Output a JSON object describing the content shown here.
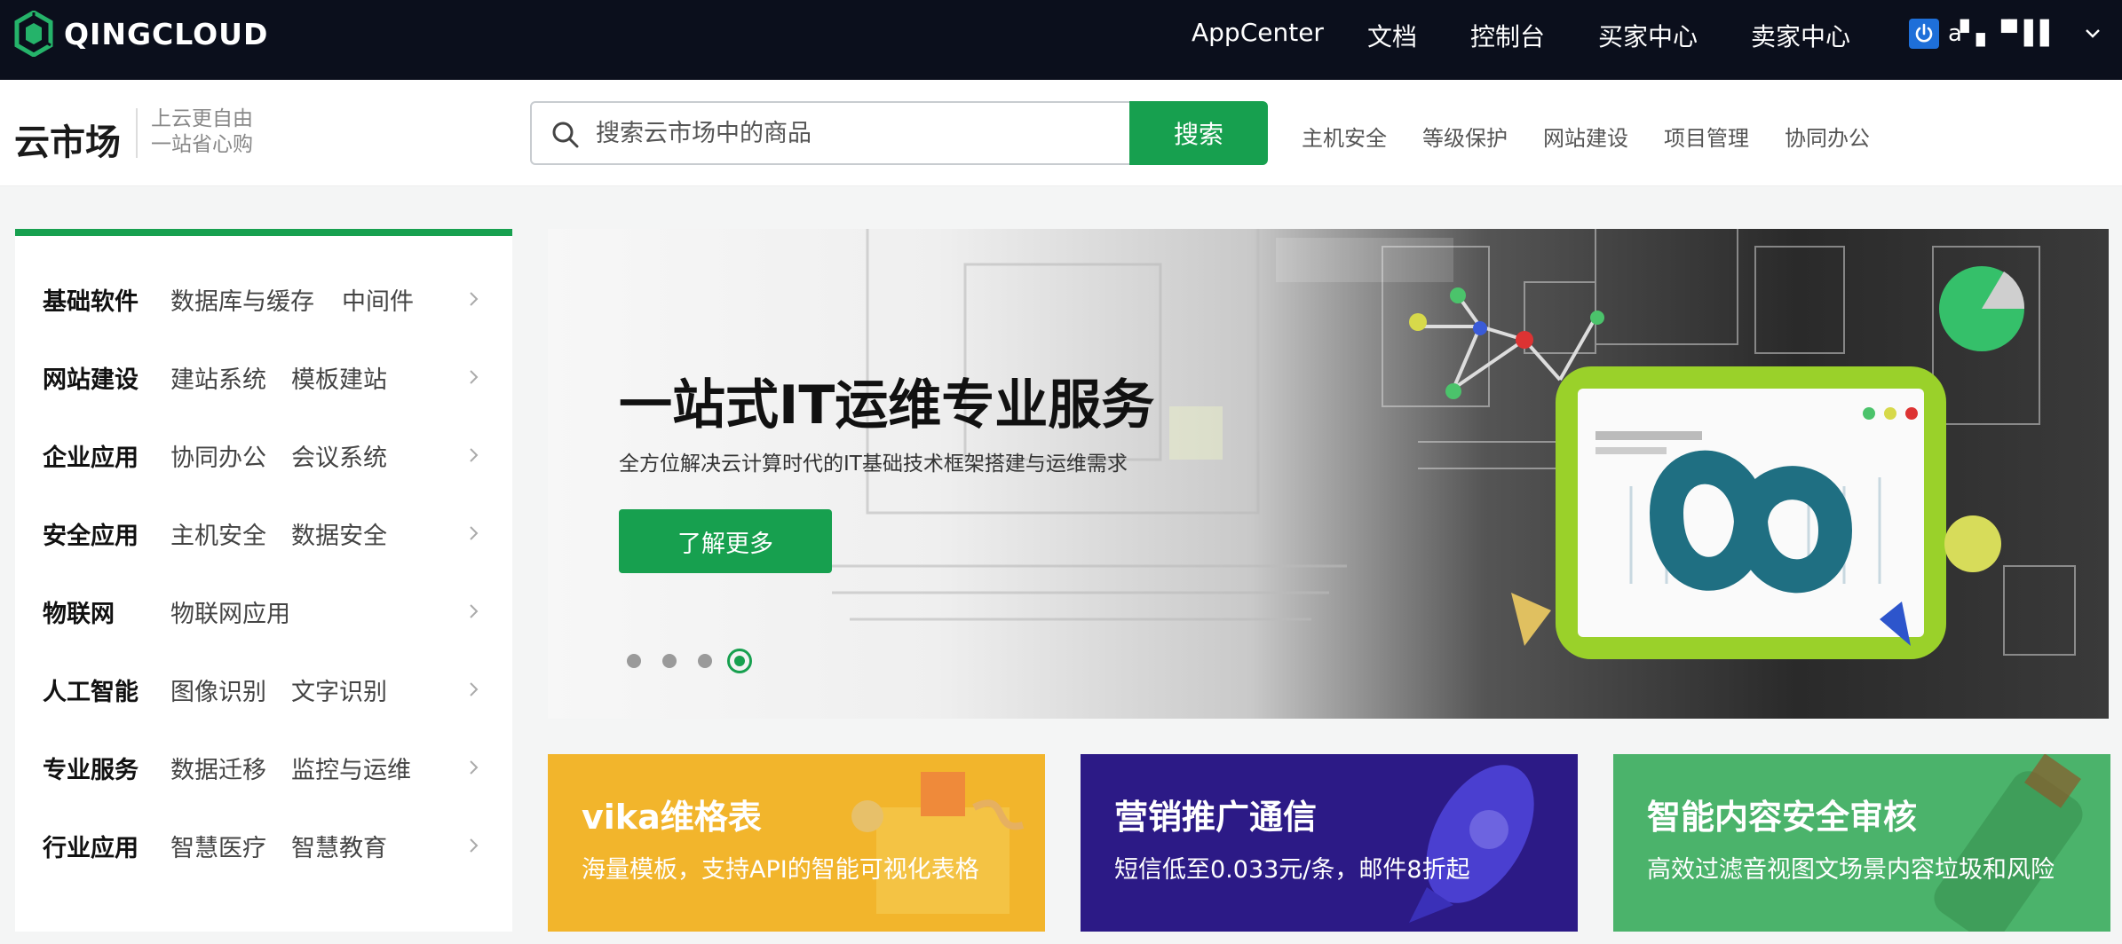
{
  "topnav": {
    "logo_text": "QINGCLOUD",
    "links": [
      "AppCenter",
      "文档",
      "控制台",
      "买家中心",
      "卖家中心"
    ],
    "user_name": "a▘▖▝▘▌▌"
  },
  "header": {
    "brand": "云市场",
    "slogan_line1": "上云更自由",
    "slogan_line2": "一站省心购",
    "search_placeholder": "搜索云市场中的商品",
    "search_button": "搜索",
    "hot_links": [
      "主机安全",
      "等级保护",
      "网站建设",
      "项目管理",
      "协同办公"
    ]
  },
  "categories": [
    {
      "title": "基础软件",
      "subs": [
        "数据库与缓存",
        "中间件"
      ]
    },
    {
      "title": "网站建设",
      "subs": [
        "建站系统",
        "模板建站"
      ]
    },
    {
      "title": "企业应用",
      "subs": [
        "协同办公",
        "会议系统"
      ]
    },
    {
      "title": "安全应用",
      "subs": [
        "主机安全",
        "数据安全"
      ]
    },
    {
      "title": "物联网",
      "subs": [
        "物联网应用"
      ]
    },
    {
      "title": "人工智能",
      "subs": [
        "图像识别",
        "文字识别"
      ]
    },
    {
      "title": "专业服务",
      "subs": [
        "数据迁移",
        "监控与运维"
      ]
    },
    {
      "title": "行业应用",
      "subs": [
        "智慧医疗",
        "智慧教育"
      ]
    }
  ],
  "banner": {
    "title": "一站式IT运维专业服务",
    "subtitle": "全方位解决云计算时代的IT基础技术框架搭建与运维需求",
    "button": "了解更多",
    "active_dot": 3,
    "dot_count": 4
  },
  "promos": [
    {
      "title": "vika维格表",
      "subtitle": "海量模板，支持API的智能可视化表格",
      "color": "#f2b52c"
    },
    {
      "title": "营销推广通信",
      "subtitle": "短信低至0.033元/条，邮件8折起",
      "color": "#2c1a86"
    },
    {
      "title": "智能内容安全审核",
      "subtitle": "高效过滤音视图文场景内容垃圾和风险",
      "color": "#4bb36b"
    }
  ],
  "colors": {
    "accent": "#17a04f",
    "nav_bg": "#0b0f1c"
  }
}
